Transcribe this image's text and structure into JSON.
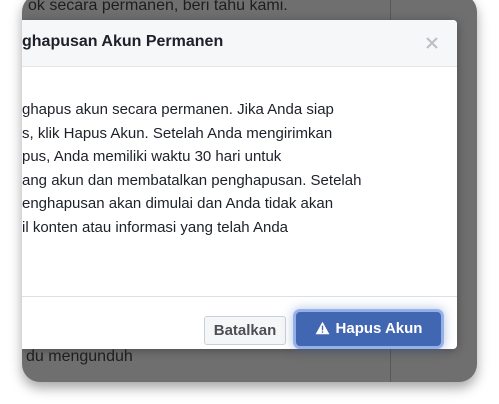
{
  "background": {
    "top_text": "ok secara permanen, beri tahu kami.",
    "bottom_text": "du mengunduh"
  },
  "dialog": {
    "title": "ghapusan Akun Permanen",
    "close_icon": "close-icon",
    "body_lines": [
      "ghapus akun secara permanen. Jika Anda siap",
      "s, klik Hapus Akun. Setelah Anda mengirimkan",
      "pus, Anda memiliki waktu 30 hari untuk",
      "ang akun dan membatalkan penghapusan. Setelah",
      "enghapusan akan dimulai dan Anda tidak akan",
      "il konten atau informasi yang telah Anda"
    ],
    "cancel_label": "Batalkan",
    "delete_label": "Hapus Akun",
    "delete_icon": "warning-icon"
  },
  "colors": {
    "primary": "#4267b2",
    "backdrop": "#6f6f6f"
  }
}
